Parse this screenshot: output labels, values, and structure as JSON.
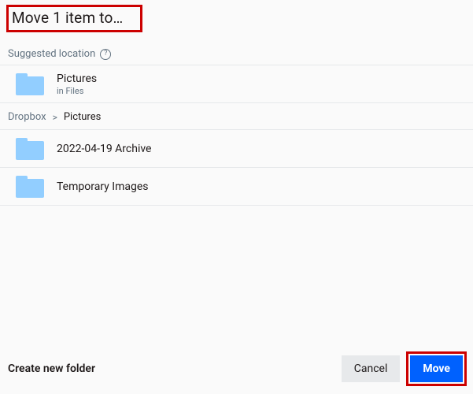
{
  "dialog": {
    "title": "Move 1 item to…"
  },
  "suggested": {
    "label": "Suggested location",
    "folder": {
      "name": "Pictures",
      "sub": "in Files"
    }
  },
  "breadcrumb": {
    "root": "Dropbox",
    "separator": ">",
    "current": "Pictures"
  },
  "folders": [
    {
      "name": "2022-04-19 Archive"
    },
    {
      "name": "Temporary Images"
    }
  ],
  "footer": {
    "createFolder": "Create new folder",
    "cancel": "Cancel",
    "move": "Move"
  },
  "icons": {
    "help": "?"
  },
  "colors": {
    "highlight": "#c00",
    "primary": "#0061fe",
    "folder": "#92ceff"
  }
}
